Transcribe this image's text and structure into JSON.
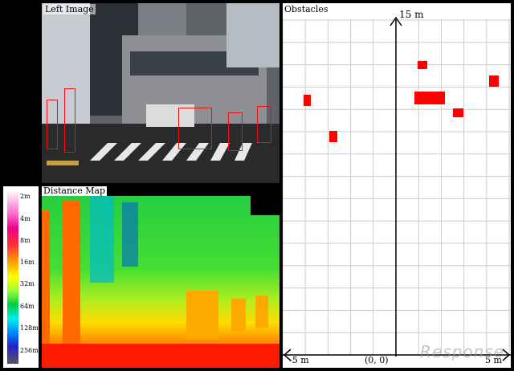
{
  "left_image": {
    "title": "Left Image",
    "detections": 6
  },
  "distance_map": {
    "title": "Distance Map"
  },
  "legend": {
    "ticks": [
      "2m",
      "4m",
      "8m",
      "16m",
      "32m",
      "64m",
      "128m",
      "256m"
    ]
  },
  "obstacles": {
    "title": "Obstacles",
    "top_label": "15 m",
    "left_label": "-5 m",
    "origin_label": "(0, 0)",
    "right_label": "5 m",
    "color": "#ff0000"
  },
  "watermark": "Response",
  "colors": {
    "obstacle": "#ff0000",
    "grid": "#cccccc",
    "detection_box": "#ee1111"
  }
}
